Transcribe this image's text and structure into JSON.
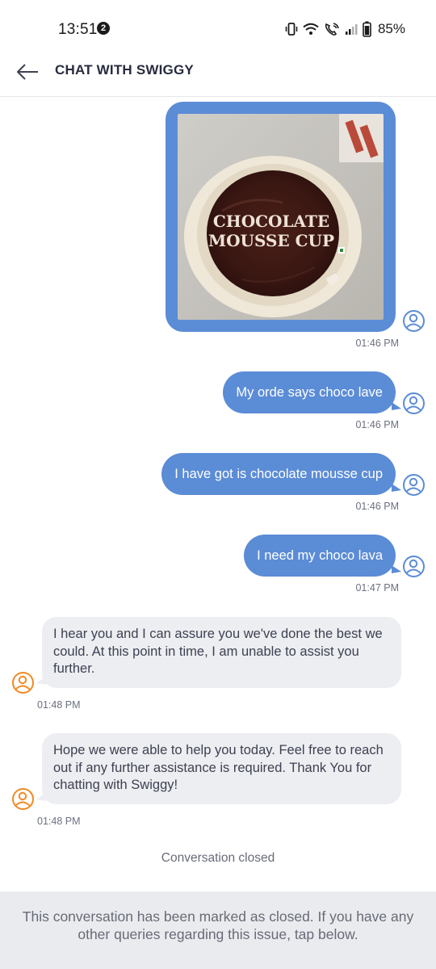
{
  "status_bar": {
    "time": "13:51",
    "notification_count": "2",
    "battery": "85%",
    "icons": [
      "vibrate-icon",
      "wifi-icon",
      "wifi-calling-icon",
      "signal-icon",
      "battery-icon"
    ]
  },
  "header": {
    "title": "CHAT WITH SWIGGY",
    "back_icon": "back-arrow-icon"
  },
  "image_message": {
    "label_line1": "CHOCOLATE",
    "label_line2": "MOUSSE CUP",
    "time": "01:46 PM"
  },
  "messages": [
    {
      "from": "user",
      "text": "My orde says choco lave",
      "time": "01:46 PM"
    },
    {
      "from": "user",
      "text": "I have got is chocolate mousse cup",
      "time": "01:46 PM"
    },
    {
      "from": "user",
      "text": "I need my choco lava",
      "time": "01:47 PM"
    },
    {
      "from": "bot",
      "text": "I hear you and I can assure you we've done the best we could. At this point in time, I am unable to assist you further.",
      "time": "01:48 PM"
    },
    {
      "from": "bot",
      "text": "Hope we were able to help you today. Feel free to reach out if any further assistance is required. Thank You for chatting with Swiggy!",
      "time": "01:48 PM"
    }
  ],
  "conversation_status": "Conversation closed",
  "footer": {
    "text": "This conversation has been marked as closed. If you have any other queries regarding this issue, tap below."
  },
  "colors": {
    "user_bubble": "#5b8cd6",
    "bot_bubble": "#edeef1",
    "bot_avatar": "#f08a24",
    "footer_bg": "#e9ebee"
  }
}
